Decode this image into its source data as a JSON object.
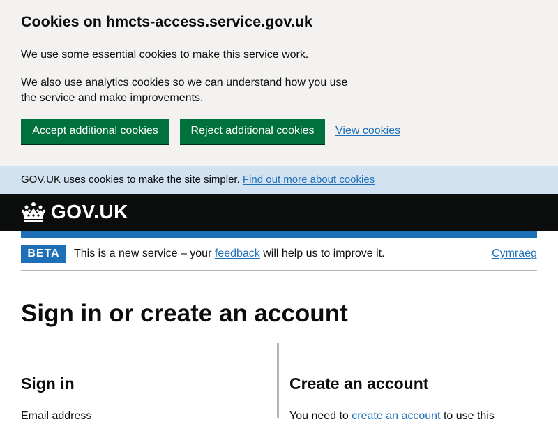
{
  "cookie_banner": {
    "title": "Cookies on hmcts-access.service.gov.uk",
    "para1": "We use some essential cookies to make this service work.",
    "para2": "We also use analytics cookies so we can understand how you use the service and make improvements.",
    "accept_label": "Accept additional cookies",
    "reject_label": "Reject additional cookies",
    "view_label": "View cookies"
  },
  "info_strip": {
    "text": "GOV.UK uses cookies to make the site simpler.",
    "link": "Find out more about cookies"
  },
  "header": {
    "logo_text": "GOV.UK",
    "logo_icon": "crown-icon"
  },
  "beta": {
    "tag": "BETA",
    "text_before": "This is a new service – your",
    "link": "feedback",
    "text_after": "will help us to improve it.",
    "language_link": "Cymraeg"
  },
  "main": {
    "title": "Sign in or create an account",
    "sign_in": {
      "heading": "Sign in",
      "email_label": "Email address"
    },
    "create_account": {
      "heading": "Create an account",
      "text_before": "You need to",
      "link": "create an account",
      "text_after": "to use this"
    }
  },
  "colors": {
    "button_green": "#00703c",
    "link_blue": "#1d70b8",
    "header_black": "#0b0c0c",
    "banner_grey": "#f3f2f1",
    "strip_blue": "#d2e2f1"
  }
}
